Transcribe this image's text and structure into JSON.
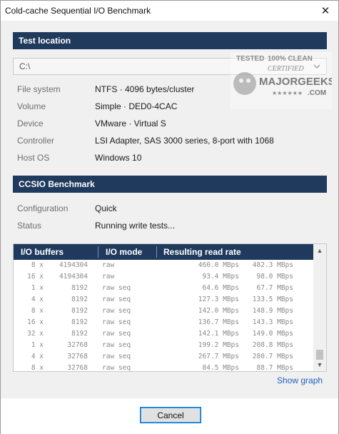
{
  "window": {
    "title": "Cold-cache Sequential I/O Benchmark"
  },
  "test_location": {
    "header": "Test location",
    "drive": "C:\\",
    "fields": [
      {
        "label": "File system",
        "value": "NTFS  ·  4096 bytes/cluster"
      },
      {
        "label": "Volume",
        "value": "Simple  ·  DED0-4CAC"
      },
      {
        "label": "Device",
        "value": "VMware  ·  Virtual S"
      },
      {
        "label": "Controller",
        "value": "LSI Adapter, SAS 3000 series, 8-port with 1068"
      },
      {
        "label": "Host OS",
        "value": "Windows 10"
      }
    ]
  },
  "watermark": {
    "line1": "TESTED",
    "line2": "100% CLEAN",
    "line3": "CERTIFIED",
    "brand": "MAJORGEEKS",
    "tld": ".COM",
    "stars": "★★★★★★"
  },
  "benchmark": {
    "header": "CCSIO Benchmark",
    "fields": [
      {
        "label": "Configuration",
        "value": "Quick"
      },
      {
        "label": "Status",
        "value": "Running write tests..."
      }
    ],
    "columns": [
      "I/O buffers",
      "I/O mode",
      "Resulting read rate"
    ],
    "rows": [
      {
        "count": "8 x",
        "size": "4194304",
        "mode": "raw",
        "rate": "460.0 MBps",
        "rate2": "482.3 MBps"
      },
      {
        "count": "16 x",
        "size": "4194304",
        "mode": "raw",
        "rate": "93.4 MBps",
        "rate2": "98.0 MBps"
      },
      {
        "count": "1 x",
        "size": "8192",
        "mode": "raw seq",
        "rate": "64.6 MBps",
        "rate2": "67.7 MBps"
      },
      {
        "count": "4 x",
        "size": "8192",
        "mode": "raw seq",
        "rate": "127.3 MBps",
        "rate2": "133.5 MBps"
      },
      {
        "count": "8 x",
        "size": "8192",
        "mode": "raw seq",
        "rate": "142.0 MBps",
        "rate2": "148.9 MBps"
      },
      {
        "count": "16 x",
        "size": "8192",
        "mode": "raw seq",
        "rate": "136.7 MBps",
        "rate2": "143.3 MBps"
      },
      {
        "count": "32 x",
        "size": "8192",
        "mode": "raw seq",
        "rate": "142.1 MBps",
        "rate2": "149.0 MBps"
      },
      {
        "count": "1 x",
        "size": "32768",
        "mode": "raw seq",
        "rate": "199.2 MBps",
        "rate2": "208.8 MBps"
      },
      {
        "count": "4 x",
        "size": "32768",
        "mode": "raw seq",
        "rate": "267.7 MBps",
        "rate2": "280.7 MBps"
      },
      {
        "count": "8 x",
        "size": "32768",
        "mode": "raw seq",
        "rate": "84.5 MBps",
        "rate2": "88.7 MBps"
      }
    ],
    "show_graph": "Show graph"
  },
  "buttons": {
    "cancel": "Cancel"
  },
  "icons": {
    "close": "close-icon",
    "dropdown": "chevron-down-icon",
    "scroll_up": "scroll-up-icon",
    "scroll_down": "scroll-down-icon"
  },
  "colors": {
    "header_bg": "#1f3a5c",
    "link": "#1f5fbf",
    "dialog_bg": "#f0f0f0",
    "focus_border": "#0078d7"
  }
}
